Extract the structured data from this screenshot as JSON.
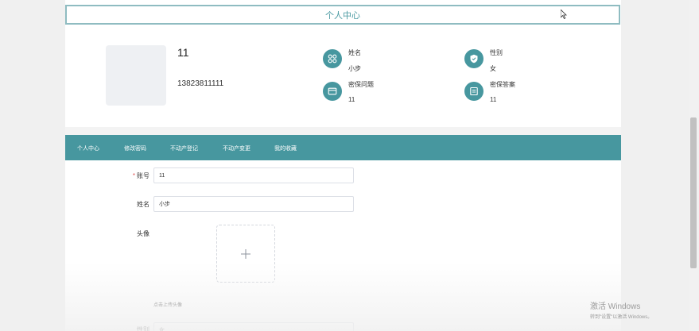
{
  "header": {
    "title": "个人中心"
  },
  "profile": {
    "name": "11",
    "phone": "13823811111",
    "fields": [
      {
        "label": "姓名",
        "value": "小步",
        "icon": "grid-icon"
      },
      {
        "label": "性别",
        "value": "女",
        "icon": "shield-icon"
      },
      {
        "label": "密保问题",
        "value": "11",
        "icon": "card-icon"
      },
      {
        "label": "密保答案",
        "value": "11",
        "icon": "edit-doc-icon"
      }
    ]
  },
  "nav": {
    "items": [
      "个人中心",
      "修改密码",
      "不动产登记",
      "不动产变更",
      "我的收藏"
    ]
  },
  "form": {
    "account_label": "账号",
    "account_value": "11",
    "name_label": "姓名",
    "name_value": "小步",
    "avatar_label": "头像",
    "upload_hint": "点击上传头像",
    "gender_label": "性别",
    "gender_value": "女"
  },
  "windows": {
    "line1": "激活 Windows",
    "line2": "转到\"设置\"以激活 Windows。"
  },
  "colors": {
    "accent": "#47979f",
    "title_border": "#8fbcc1",
    "required": "#e05656"
  }
}
